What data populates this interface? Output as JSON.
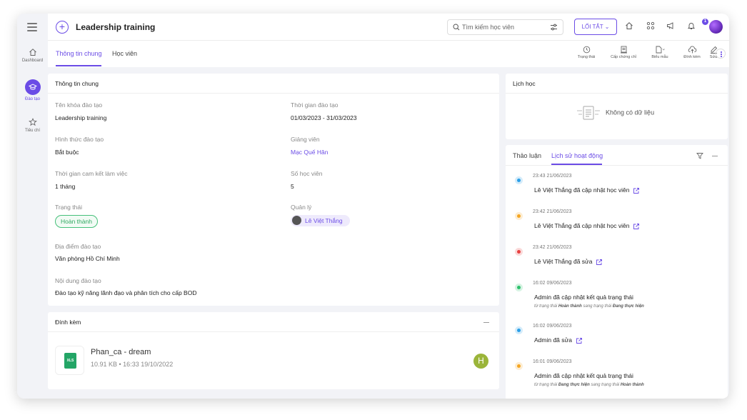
{
  "sidebar": {
    "items": [
      {
        "label": "Dashboard"
      },
      {
        "label": "Đào tạo"
      },
      {
        "label": "Tiêu chí"
      }
    ]
  },
  "header": {
    "title": "Leadership training",
    "search_placeholder": "Tìm kiếm học viên",
    "shortcut_label": "LỐI TẮT ⌄",
    "notification_count": "1"
  },
  "tabs": [
    {
      "label": "Thông tin chung"
    },
    {
      "label": "Học viên"
    }
  ],
  "actions": [
    {
      "label": "Trạng thái"
    },
    {
      "label": "Cấp chứng chỉ"
    },
    {
      "label": "Biểu mẫu"
    },
    {
      "label": "Đính kèm"
    },
    {
      "label": "Sửa"
    }
  ],
  "info": {
    "section_title": "Thông tin chung",
    "course_name_label": "Tên khóa đào tạo",
    "course_name": "Leadership training",
    "period_label": "Thời gian đào tạo",
    "period": "01/03/2023 - 31/03/2023",
    "format_label": "Hình thức đào tạo",
    "format": "Bắt buộc",
    "instructor_label": "Giảng viên",
    "instructor": "Mạc Quế Hân",
    "commitment_label": "Thời gian cam kết làm việc",
    "commitment": "1 tháng",
    "students_label": "Số học viên",
    "students": "5",
    "status_label": "Trạng thái",
    "status": "Hoàn thành",
    "manager_label": "Quản lý",
    "manager": "Lê Việt Thắng",
    "location_label": "Địa điểm đào tạo",
    "location": "Văn phòng Hồ Chí Minh",
    "content_label": "Nội dung đào tạo",
    "content": "Đào tạo kỹ năng lãnh đạo và phân tích cho cấp BOD"
  },
  "attachments": {
    "title": "Đính kèm",
    "file_badge": "XLS",
    "file_name": "Phan_ca - dream",
    "file_meta": "10.91 KB • 16:33 19/10/2022",
    "uploader_initial": "H"
  },
  "schedule": {
    "title": "Lịch học",
    "empty_text": "Không có dữ liệu"
  },
  "activity": {
    "tabs": [
      {
        "label": "Thảo luận"
      },
      {
        "label": "Lịch sử hoạt động"
      }
    ],
    "items": [
      {
        "time": "23:43 21/06/2023",
        "text": "Lê Việt Thắng đã cập nhật học viên",
        "color": "#2b9fe8",
        "sub": null
      },
      {
        "time": "23:42 21/06/2023",
        "text": "Lê Việt Thắng đã cập nhật học viên",
        "color": "#f5a623",
        "sub": null
      },
      {
        "time": "23:42 21/06/2023",
        "text": "Lê Việt Thắng đã sửa",
        "color": "#e84040",
        "sub": null
      },
      {
        "time": "16:02 09/06/2023",
        "text": "Admin đã cập nhật kết quả trạng thái",
        "color": "#2ec16c",
        "sub": {
          "p1": "từ trạng thái",
          "b1": "Hoàn thành",
          "p2": "sang trạng thái",
          "b2": "Đang thực hiện"
        }
      },
      {
        "time": "16:02 09/06/2023",
        "text": "Admin đã sửa",
        "color": "#2b9fe8",
        "sub": null
      },
      {
        "time": "16:01 09/06/2023",
        "text": "Admin đã cập nhật kết quả trạng thái",
        "color": "#f5a623",
        "sub": {
          "p1": "từ trạng thái",
          "b1": "Đang thực hiện",
          "p2": "sang trạng thái",
          "b2": "Hoàn thành"
        }
      }
    ]
  },
  "colors": {
    "accent": "#6b4ce6",
    "success": "#2ea860"
  }
}
